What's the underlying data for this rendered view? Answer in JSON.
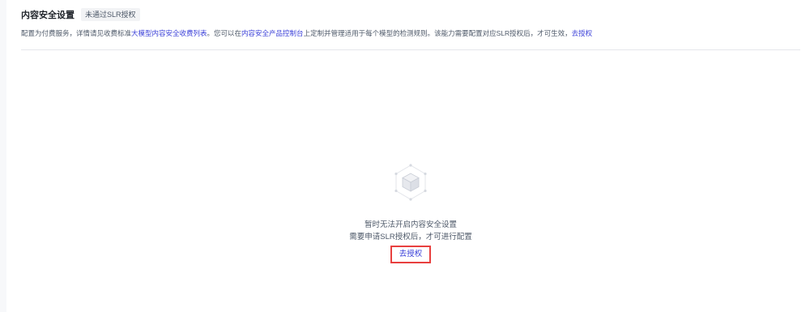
{
  "header": {
    "title": "内容安全设置",
    "status_tag": "未通过SLR授权"
  },
  "notice": {
    "text_before_link": "配置为付费服务，详情请见收费标准",
    "link_text": "大模型内容安全收费列表",
    "text_middle": "。您可以在",
    "console_link_text": "内容安全产品控制台",
    "text_after_console": "上定制并管理适用于每个模型的检测规则。该能力需要配置对应SLR授权后，才可生效，",
    "action_link_text": "去授权"
  },
  "empty_state": {
    "icon": "package-cube-icon",
    "line1": "暂时无法开启内容安全设置",
    "line2": "需要申请SLR授权后，才可进行配置",
    "button_label": "去授权"
  },
  "colors": {
    "accent": "#3a3fd8",
    "highlight_border": "#e8403f",
    "text_secondary": "#4e5969",
    "title": "#1f2329"
  }
}
